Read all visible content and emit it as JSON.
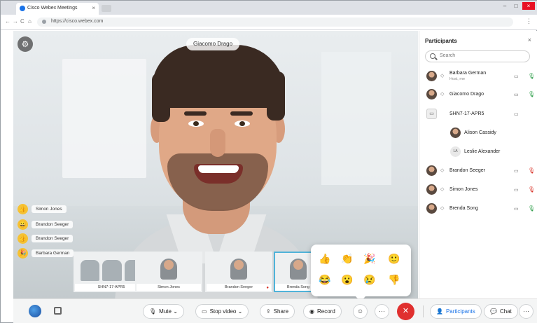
{
  "browser": {
    "tab_title": "Cisco Webex Meetings",
    "tab_close": "×",
    "url": "https://cisco.webex.com",
    "nav_back": "←",
    "nav_forward": "→",
    "nav_reload": "C",
    "nav_home": "⌂",
    "menu": "⋮",
    "win_min": "–",
    "win_max": "□",
    "win_close": "×"
  },
  "stage": {
    "speaker_name": "Giacomo Drago",
    "gear_glyph": "⚙"
  },
  "reaction_feed": [
    {
      "emoji": "👍",
      "name": "Simon Jones"
    },
    {
      "emoji": "😀",
      "name": "Brandon Seeger"
    },
    {
      "emoji": "👍",
      "name": "Brandon Seeger"
    },
    {
      "emoji": "🎉",
      "name": "Barbara German"
    }
  ],
  "filmstrip": [
    {
      "label": "SHN7-17-APR5",
      "type": "room"
    },
    {
      "label": "Simon Jones",
      "type": "person"
    },
    {
      "label": "Brandon Seeger",
      "type": "person"
    },
    {
      "label": "Brenda Song",
      "type": "person"
    }
  ],
  "reactions_popover": {
    "row1": [
      "👍",
      "👏",
      "🎉",
      "🙂"
    ],
    "row2": [
      "😂",
      "😮",
      "😢",
      "👎"
    ]
  },
  "participants_panel": {
    "title": "Participants",
    "close": "×",
    "search_placeholder": "Search",
    "rows": [
      {
        "name": "Barbara German",
        "sub": "Host, me",
        "role": "◇",
        "cam": "▭",
        "mic": "🎙",
        "muted": false,
        "avatar": "photo"
      },
      {
        "name": "Giacomo Drago",
        "sub": "",
        "role": "◇",
        "cam": "▭",
        "mic": "🎙",
        "muted": false,
        "avatar": "photo"
      },
      {
        "name": "SHN7-17-APR5",
        "sub": "",
        "role": "",
        "cam": "▭",
        "mic": "",
        "muted": false,
        "avatar": "device"
      },
      {
        "name": "Alison Cassidy",
        "sub": "",
        "role": "",
        "cam": "",
        "mic": "",
        "muted": false,
        "avatar": "photo",
        "indent": true
      },
      {
        "name": "Leslie Alexander",
        "sub": "",
        "role": "",
        "cam": "",
        "mic": "",
        "muted": false,
        "avatar": "initials",
        "initials": "LA",
        "indent": true
      },
      {
        "name": "Brandon Seeger",
        "sub": "",
        "role": "◇",
        "cam": "▭",
        "mic": "🎙",
        "muted": true,
        "avatar": "photo"
      },
      {
        "name": "Simon Jones",
        "sub": "",
        "role": "◇",
        "cam": "▭",
        "mic": "🎙",
        "muted": true,
        "avatar": "photo"
      },
      {
        "name": "Brenda Song",
        "sub": "",
        "role": "◇",
        "cam": "▭",
        "mic": "🎙",
        "muted": false,
        "avatar": "photo"
      }
    ]
  },
  "controls": {
    "mute_label": "Mute",
    "mute_icon": "🎙",
    "stop_video_label": "Stop video",
    "stop_video_icon": "▭",
    "share_label": "Share",
    "share_icon": "⇪",
    "record_label": "Record",
    "record_icon": "◉",
    "reactions_icon": "☺",
    "more_icon": "···",
    "end_icon": "✕",
    "participants_label": "Participants",
    "participants_icon": "👤",
    "chat_label": "Chat",
    "chat_icon": "💬",
    "overflow_icon": "···",
    "chevron": "⌄"
  },
  "colors": {
    "accent_blue": "#1a73e8",
    "end_red": "#e0302f",
    "unmuted_green": "#2e9e4a",
    "muted_red": "#d93025"
  }
}
